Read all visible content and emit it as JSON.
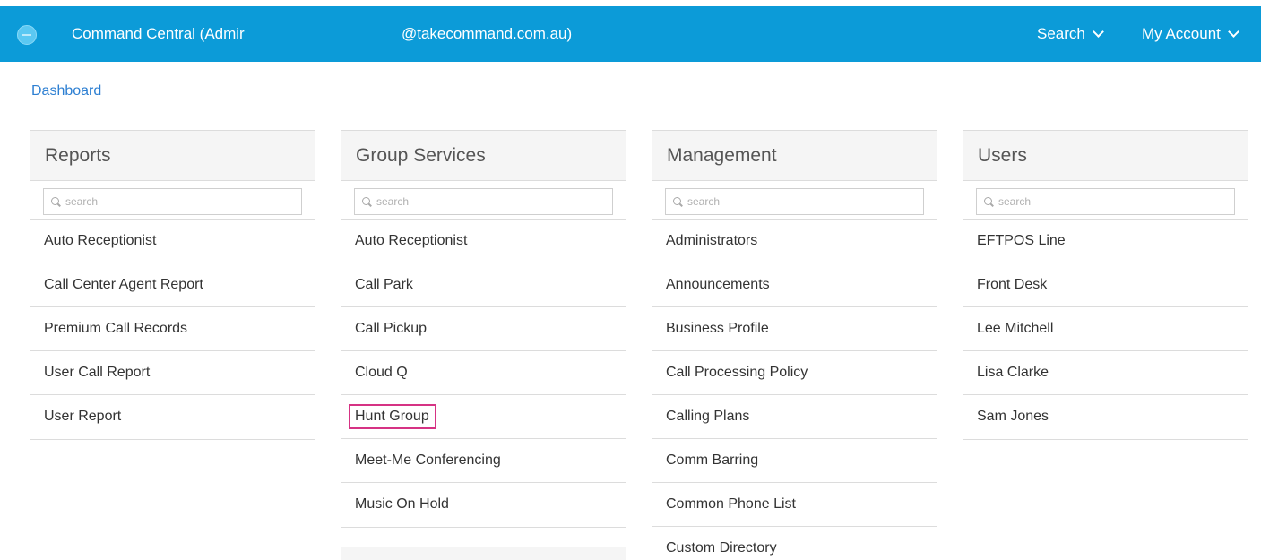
{
  "header": {
    "app_title": "Command Central (Admir",
    "account_email": "@takecommand.com.au)",
    "search_label": "Search",
    "account_label": "My Account"
  },
  "breadcrumb": {
    "label": "Dashboard"
  },
  "panels": {
    "reports": {
      "title": "Reports",
      "search_placeholder": "search",
      "items": [
        "Auto Receptionist",
        "Call Center Agent Report",
        "Premium Call Records",
        "User Call Report",
        "User Report"
      ]
    },
    "group_services": {
      "title": "Group Services",
      "search_placeholder": "search",
      "items": [
        "Auto Receptionist",
        "Call Park",
        "Call Pickup",
        "Cloud Q",
        "Hunt Group",
        "Meet-Me Conferencing",
        "Music On Hold"
      ],
      "highlighted_item": "Hunt Group"
    },
    "management": {
      "title": "Management",
      "search_placeholder": "search",
      "items": [
        "Administrators",
        "Announcements",
        "Business Profile",
        "Call Processing Policy",
        "Calling Plans",
        "Comm Barring",
        "Common Phone List",
        "Custom Directory"
      ]
    },
    "users": {
      "title": "Users",
      "search_placeholder": "search",
      "items": [
        "EFTPOS Line",
        "Front Desk",
        "Lee Mitchell",
        "Lisa Clarke",
        "Sam Jones"
      ]
    }
  },
  "colors": {
    "header_bg": "#0c9bd8",
    "link": "#2d7fd2",
    "highlight_border": "#d63384"
  },
  "icons": {
    "logo": "brand-logo-icon",
    "search": "search-icon",
    "chevron": "chevron-down-icon"
  }
}
